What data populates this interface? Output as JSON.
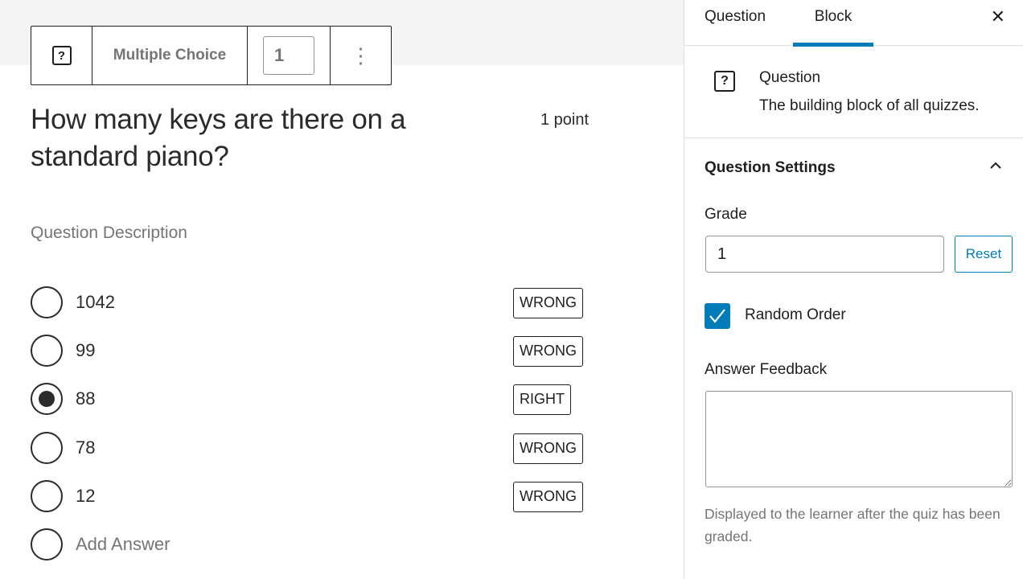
{
  "toolbar": {
    "block_icon": "?",
    "question_type": "Multiple Choice",
    "question_number": "1",
    "more_icon": "⋮"
  },
  "question": {
    "title": "How many keys are there on a standard piano?",
    "points": "1 point",
    "description_placeholder": "Question Description",
    "answers": [
      {
        "text": "1042",
        "selected": false,
        "status": "WRONG"
      },
      {
        "text": "99",
        "selected": false,
        "status": "WRONG"
      },
      {
        "text": "88",
        "selected": true,
        "status": "RIGHT"
      },
      {
        "text": "78",
        "selected": false,
        "status": "WRONG"
      },
      {
        "text": "12",
        "selected": false,
        "status": "WRONG"
      }
    ],
    "add_answer_placeholder": "Add Answer"
  },
  "sidebar": {
    "tabs": [
      {
        "label": "Question",
        "active": false
      },
      {
        "label": "Block",
        "active": true
      }
    ],
    "close_icon": "✕",
    "block_card": {
      "icon": "?",
      "title": "Question",
      "description": "The building block of all quizzes."
    },
    "settings": {
      "heading": "Question Settings",
      "expanded": true,
      "grade_label": "Grade",
      "grade_value": "1",
      "reset_label": "Reset",
      "random_order_label": "Random Order",
      "random_order_checked": true,
      "feedback_label": "Answer Feedback",
      "feedback_value": "",
      "feedback_help": "Displayed to the learner after the quiz has been graded."
    }
  },
  "colors": {
    "accent": "#007cba",
    "text": "#1e1e1e",
    "muted": "#757575"
  }
}
